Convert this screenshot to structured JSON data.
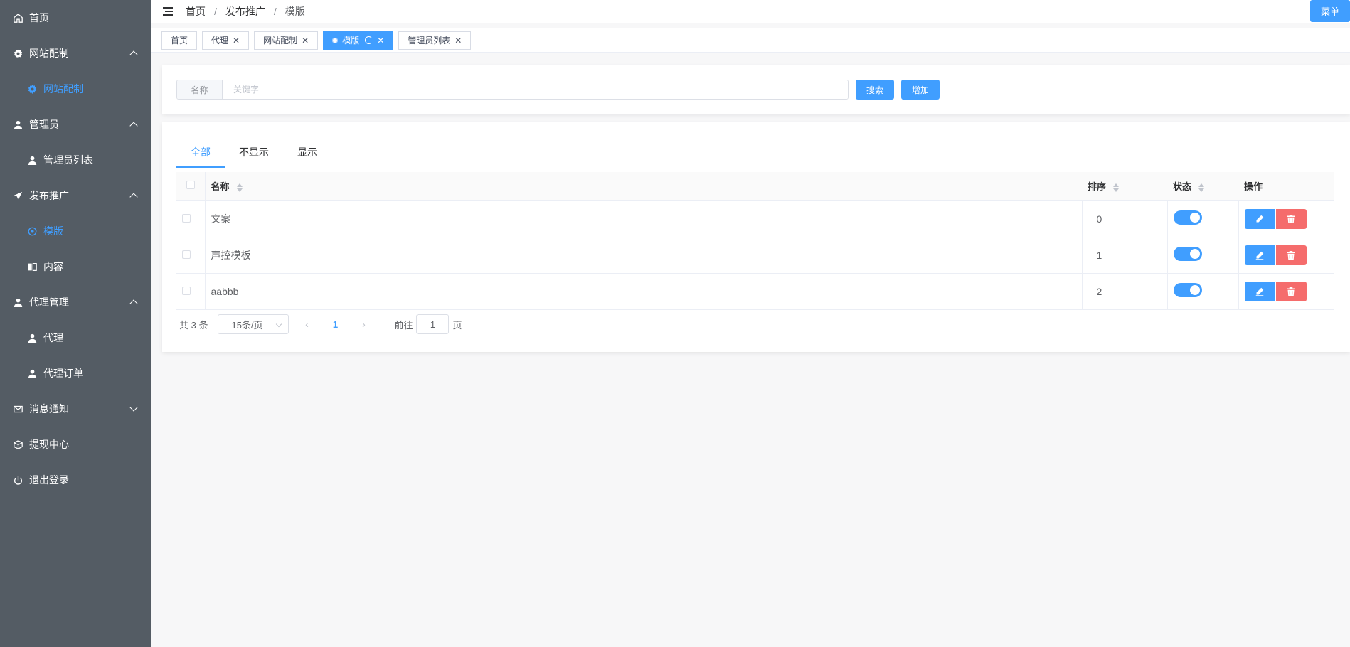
{
  "sidebar": {
    "items": [
      {
        "label": "首页",
        "icon": "home-icon"
      },
      {
        "label": "网站配制",
        "icon": "gear-icon"
      },
      {
        "label": "网站配制",
        "icon": "gear-icon"
      },
      {
        "label": "管理员",
        "icon": "user-icon"
      },
      {
        "label": "管理员列表",
        "icon": "user-icon"
      },
      {
        "label": "发布推广",
        "icon": "send-icon"
      },
      {
        "label": "模版",
        "icon": "target-icon"
      },
      {
        "label": "内容",
        "icon": "content-icon"
      },
      {
        "label": "代理管理",
        "icon": "user-icon"
      },
      {
        "label": "代理",
        "icon": "user-icon"
      },
      {
        "label": "代理订单",
        "icon": "user-icon"
      },
      {
        "label": "消息通知",
        "icon": "mail-icon"
      },
      {
        "label": "提现中心",
        "icon": "box-icon"
      },
      {
        "label": "退出登录",
        "icon": "power-icon"
      }
    ]
  },
  "header": {
    "breadcrumb": [
      "首页",
      "发布推广",
      "模版"
    ],
    "separator": "/",
    "menu_button": "菜单"
  },
  "tags": [
    "首页",
    "代理",
    "网站配制",
    "模版",
    "管理员列表"
  ],
  "search": {
    "label": "名称",
    "placeholder": "关键字",
    "search_button": "搜索",
    "add_button": "增加"
  },
  "tabs": [
    "全部",
    "不显示",
    "显示"
  ],
  "table": {
    "columns": [
      "名称",
      "排序",
      "状态",
      "操作"
    ],
    "rows": [
      {
        "name": "文案",
        "sort": "0",
        "status": true
      },
      {
        "name": "声控模板",
        "sort": "1",
        "status": true
      },
      {
        "name": "aabbb",
        "sort": "2",
        "status": true
      }
    ]
  },
  "pagination": {
    "total": "共 3 条",
    "page_size": "15条/页",
    "current_page": "1",
    "goto_label": "前往",
    "goto_value": "1",
    "page_suffix": "页"
  },
  "colors": {
    "sidebar_bg": "#545c64",
    "primary": "#409eff",
    "danger": "#f56c6c"
  }
}
